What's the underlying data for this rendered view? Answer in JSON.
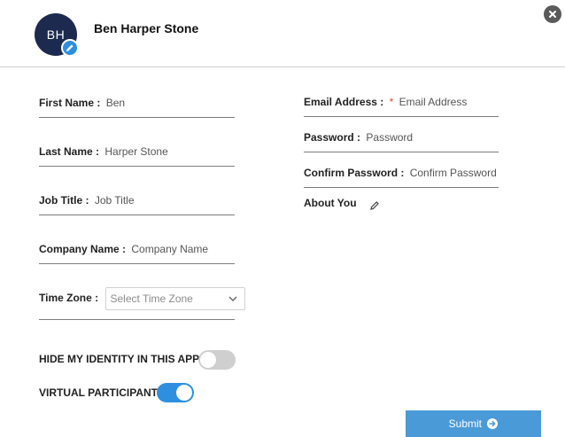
{
  "profile": {
    "initials": "BH",
    "name": "Ben Harper Stone"
  },
  "form": {
    "first_name": {
      "label": "First Name",
      "value": "Ben"
    },
    "last_name": {
      "label": "Last Name",
      "value": "Harper Stone"
    },
    "job_title": {
      "label": "Job Title",
      "placeholder": "Job Title"
    },
    "company_name": {
      "label": "Company Name",
      "placeholder": "Company Name"
    },
    "time_zone": {
      "label": "Time Zone",
      "placeholder": "Select Time Zone"
    },
    "email": {
      "label": "Email Address",
      "required_mark": "*",
      "placeholder": "Email Address"
    },
    "password": {
      "label": "Password",
      "placeholder": "Password"
    },
    "confirm_password": {
      "label": "Confirm Password",
      "placeholder": "Confirm Password"
    },
    "about": {
      "label": "About You"
    },
    "separator": ":"
  },
  "toggles": {
    "hide_identity": {
      "label": "HIDE MY IDENTITY IN THIS APP",
      "state": "off"
    },
    "virtual_participant": {
      "label": "VIRTUAL PARTICIPANT",
      "state": "on"
    }
  },
  "submit": {
    "label": "Submit"
  },
  "colors": {
    "accent": "#2f8fdf",
    "avatar_bg": "#1b2a4e",
    "submit_bg": "#4a9ad8",
    "required": "#e0463b"
  }
}
